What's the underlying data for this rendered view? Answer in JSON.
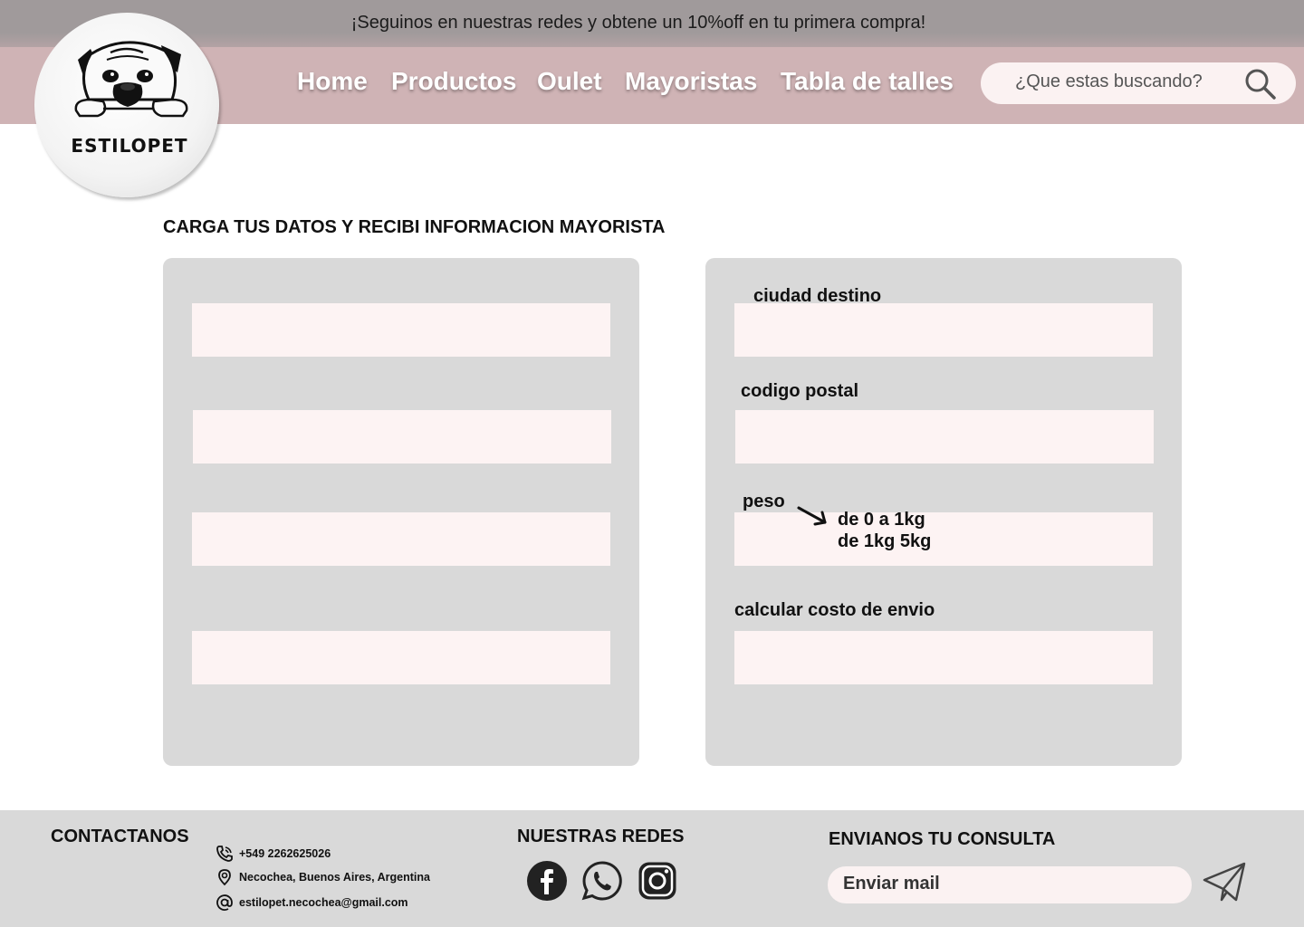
{
  "banner": {
    "text": "¡Seguinos en nuestras redes y obtene un 10%off en tu primera compra!"
  },
  "brand": {
    "name": "ESTILOPET",
    "logo_icon": "pug-dog-icon"
  },
  "nav": {
    "items": [
      {
        "label": "Home"
      },
      {
        "label": "Productos"
      },
      {
        "label": "Oulet"
      },
      {
        "label": "Mayoristas"
      },
      {
        "label": "Tabla de talles"
      }
    ]
  },
  "search": {
    "placeholder": "¿Que estas buscando?",
    "value": "",
    "icon": "search-icon"
  },
  "main": {
    "title": "CARGA TUS DATOS Y RECIBI INFORMACION MAYORISTA",
    "left_fields": [
      {
        "value": ""
      },
      {
        "value": ""
      },
      {
        "value": ""
      },
      {
        "value": ""
      }
    ],
    "right_fields": {
      "city_label": "ciudad destino",
      "postal_label": "codigo postal",
      "weight_label": "peso",
      "weight_options": [
        "de 0 a 1kg",
        "de 1kg 5kg"
      ],
      "shipping_label": "calcular costo de envio"
    }
  },
  "footer": {
    "contact": {
      "heading": "CONTACTANOS",
      "phone": "+549 2262625026",
      "address": "Necochea, Buenos Aires, Argentina",
      "email": "estilopet.necochea@gmail.com"
    },
    "social": {
      "heading": "NUESTRAS REDES",
      "icons": [
        "facebook-icon",
        "whatsapp-icon",
        "instagram-icon"
      ]
    },
    "inquiry": {
      "heading": "ENVIANOS TU CONSULTA",
      "placeholder": "Enviar mail",
      "icon": "send-icon"
    }
  },
  "colors": {
    "banner": "#a09a9b",
    "nav": "#cfb3b5",
    "panel": "#d9d9d9",
    "field": "#fdf3f3",
    "footer": "#d9d9d9"
  }
}
